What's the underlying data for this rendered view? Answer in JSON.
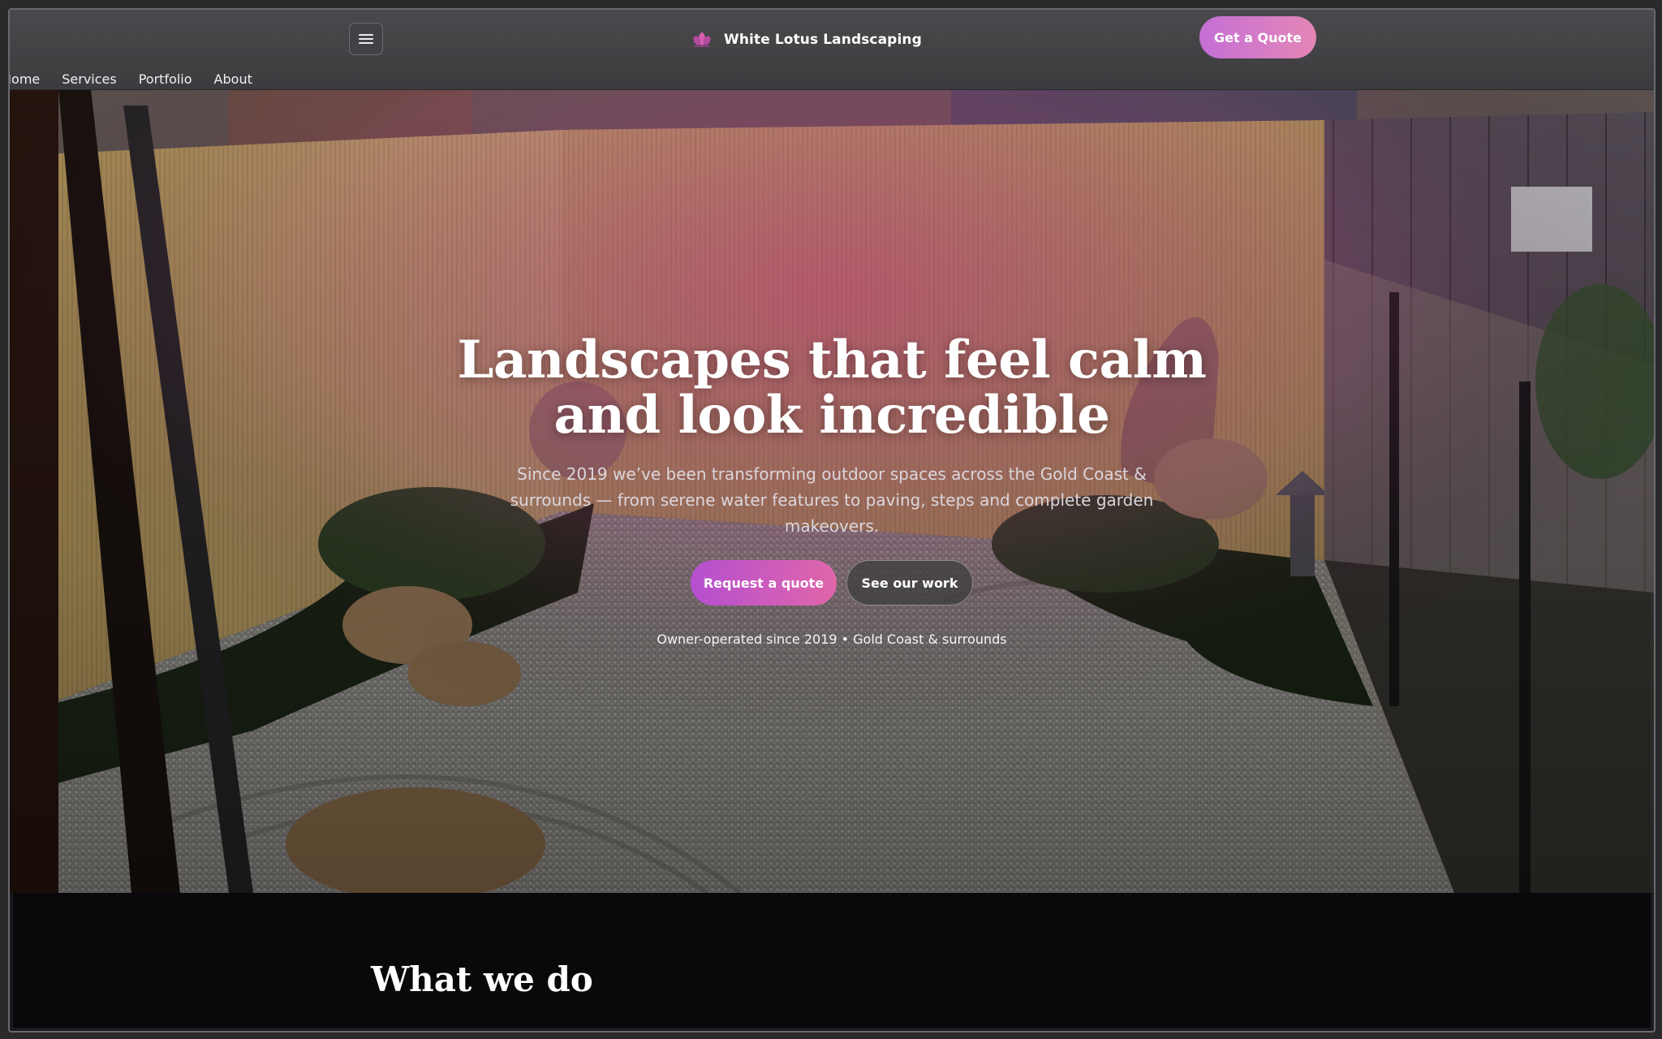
{
  "header": {
    "brand_name": "White Lotus Landscaping",
    "cta_label": "Get a Quote",
    "nav": [
      "Home",
      "Services",
      "Portfolio",
      "About"
    ]
  },
  "hero": {
    "title_line1": "Landscapes that feel calm",
    "title_line2": "and look incredible",
    "subtitle": "Since 2019 we’ve been transforming outdoor spaces across the Gold Coast & surrounds — from serene water features to paving, steps and complete garden makeovers.",
    "primary_button": "Request a quote",
    "secondary_button": "See our work",
    "note": "Owner-operated since 2019 • Gold Coast & surrounds"
  },
  "section": {
    "title": "What we do"
  },
  "colors": {
    "accent_start": "#b54fd0",
    "accent_end": "#e066a9",
    "header_bg": "#444447",
    "page_bg": "#09090b"
  },
  "icons": {
    "menu": "hamburger-menu-icon",
    "logo": "lotus-logo-icon"
  }
}
